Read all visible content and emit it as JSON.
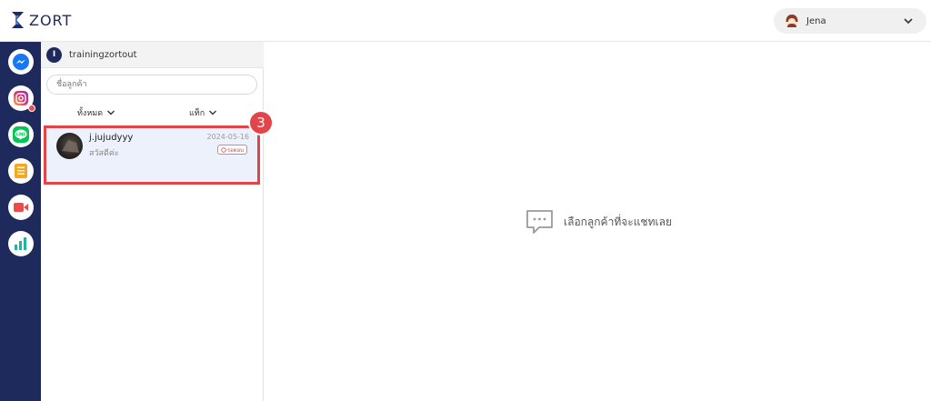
{
  "brand": {
    "name": "ZORT"
  },
  "user": {
    "name": "Jena"
  },
  "rail": {
    "items": [
      {
        "icon": "messenger-icon",
        "color": "#1877f2"
      },
      {
        "icon": "instagram-icon",
        "color": "#d6249f",
        "has_alert": true
      },
      {
        "icon": "line-icon",
        "color": "#06c755"
      },
      {
        "icon": "notes-icon",
        "color": "#f5a623"
      },
      {
        "icon": "video-icon",
        "color": "#ef4a4a"
      },
      {
        "icon": "analytics-icon",
        "color": "#1fb5a6"
      }
    ]
  },
  "shop": {
    "badge": "I",
    "name": "trainingzortout"
  },
  "search": {
    "placeholder": "ชื่อลูกค้า"
  },
  "filters": {
    "status_label": "ทั้งหมด",
    "tag_label": "แท็ก"
  },
  "conversations": [
    {
      "name": "j.jujudyyy",
      "message": "สวัสดีค่ะ",
      "date": "2024-05-16",
      "tag": "รอตอบ"
    }
  ],
  "callout": {
    "step": "3"
  },
  "main": {
    "empty_text": "เลือกลูกค้าที่จะแชทเลย"
  },
  "colors": {
    "navy": "#1f2a5c",
    "accent_red": "#e0454a",
    "row_highlight": "#ecf1fb"
  }
}
